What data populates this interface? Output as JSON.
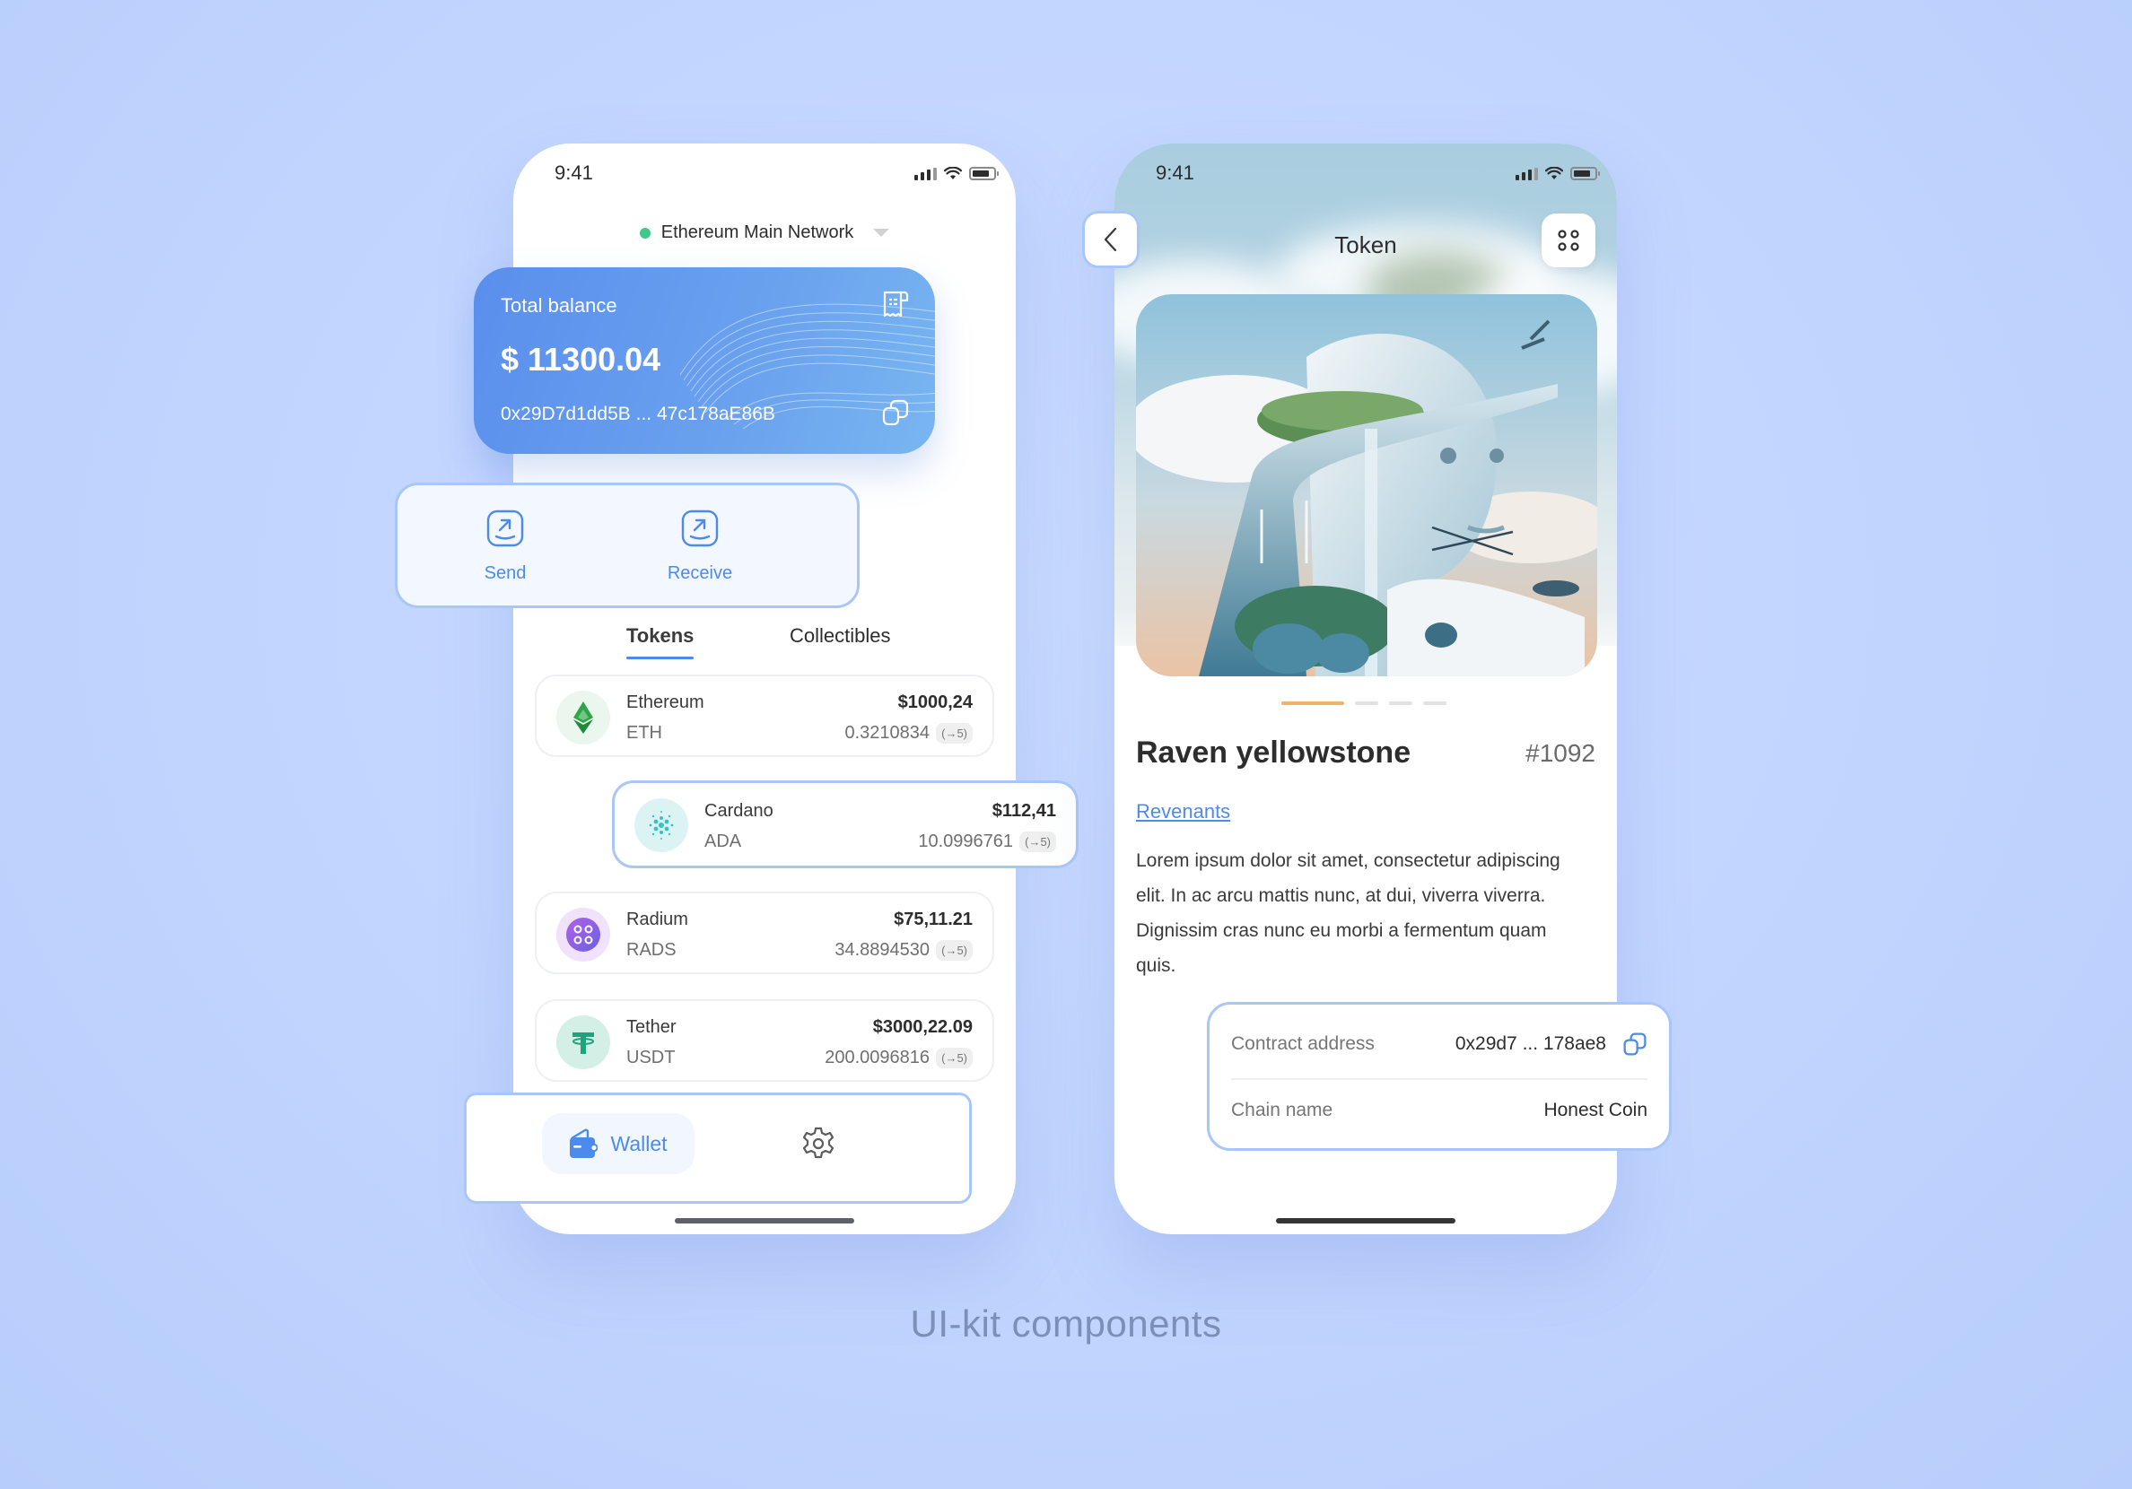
{
  "caption": "UI-kit components",
  "colors": {
    "accent": "#4d8bea",
    "outline": "#a9c6fb",
    "network_dot": "#3ec98a",
    "carousel_active": "#f0b36a",
    "background": "#c3d6ff"
  },
  "wallet_screen": {
    "status_time": "9:41",
    "network": {
      "label": "Ethereum Main Network",
      "status": "connected"
    },
    "balance_card": {
      "label": "Total balance",
      "amount": "$ 11300.04",
      "address": "0x29D7d1dd5B ... 47c178aE86B",
      "icons": [
        "receipt-icon",
        "copy-icon"
      ]
    },
    "actions": [
      {
        "label": "Send",
        "icon": "send-arrow-icon"
      },
      {
        "label": "Receive",
        "icon": "receive-arrow-icon"
      }
    ],
    "tabs": [
      {
        "label": "Tokens",
        "active": true
      },
      {
        "label": "Collectibles",
        "active": false
      }
    ],
    "tokens": [
      {
        "name": "Ethereum",
        "symbol": "ETH",
        "usd": "$1000,24",
        "amount": "0.3210834",
        "badge": "(→5)",
        "icon": "ethereum-icon",
        "highlighted": false
      },
      {
        "name": "Cardano",
        "symbol": "ADA",
        "usd": "$112,41",
        "amount": "10.0996761",
        "badge": "(→5)",
        "icon": "cardano-icon",
        "highlighted": true
      },
      {
        "name": "Radium",
        "symbol": "RADS",
        "usd": "$75,11.21",
        "amount": "34.8894530",
        "badge": "(→5)",
        "icon": "radium-icon",
        "highlighted": false
      },
      {
        "name": "Tether",
        "symbol": "USDT",
        "usd": "$3000,22.09",
        "amount": "200.0096816",
        "badge": "(→5)",
        "icon": "tether-icon",
        "highlighted": false
      }
    ],
    "bottom_nav": {
      "items": [
        {
          "label": "Wallet",
          "icon": "wallet-icon",
          "active": true
        },
        {
          "label": "",
          "icon": "settings-gear-icon",
          "active": false
        }
      ]
    }
  },
  "token_screen": {
    "status_time": "9:41",
    "title": "Token",
    "nft": {
      "name": "Raven yellowstone",
      "id": "#1092",
      "collection": "Revenants",
      "description": "Lorem ipsum dolor sit amet, consectetur adipiscing elit. In ac arcu mattis nunc, at dui, viverra viverra. Dignissim cras nunc eu morbi a fermentum quam quis.",
      "carousel": {
        "total": 4,
        "active_index": 0
      }
    },
    "details": [
      {
        "label": "Contract address",
        "value": "0x29d7 ... 178ae8",
        "copyable": true
      },
      {
        "label": "Chain name",
        "value": "Honest Coin",
        "copyable": false
      }
    ]
  }
}
